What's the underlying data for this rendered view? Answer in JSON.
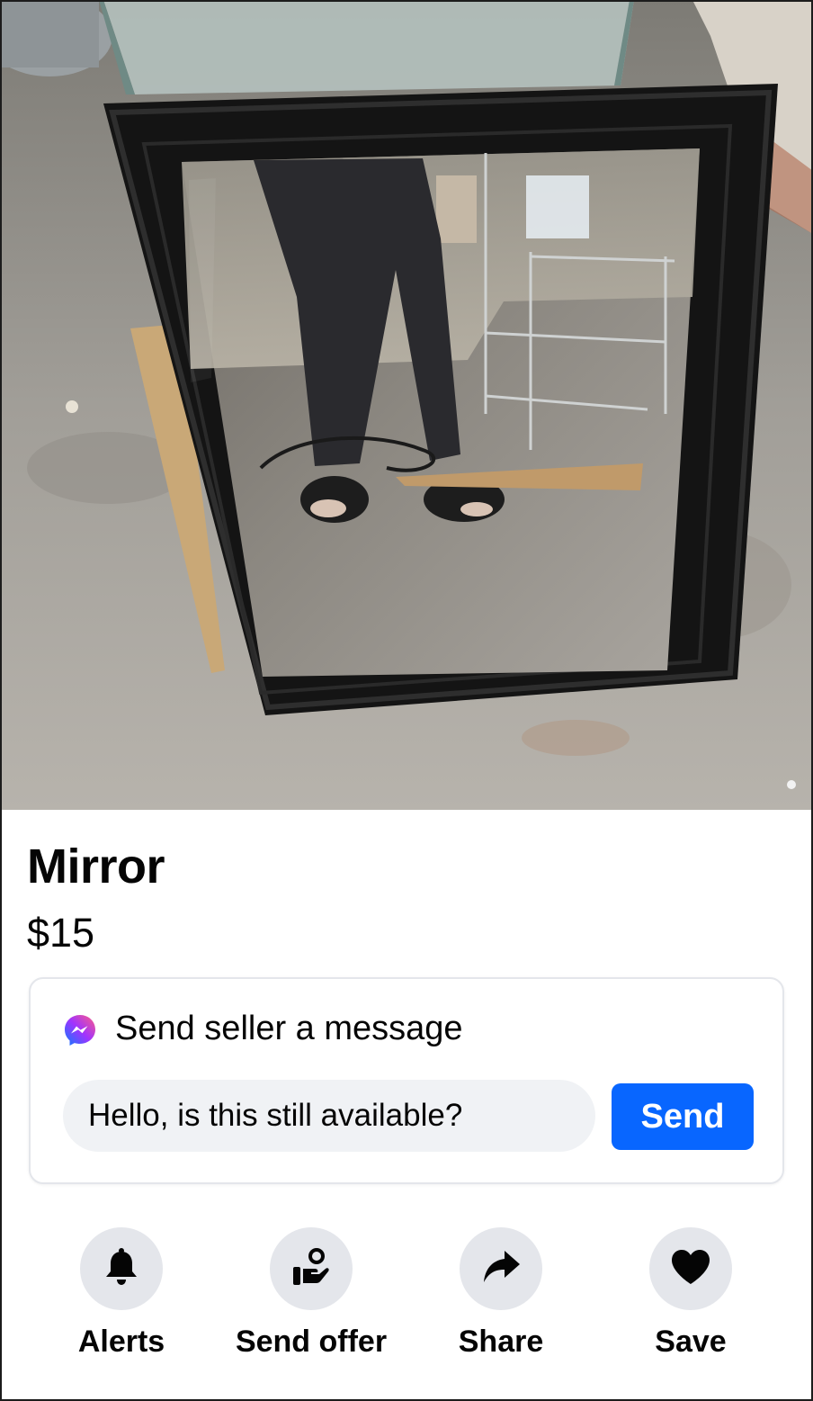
{
  "listing": {
    "title": "Mirror",
    "price": "$15",
    "photo_icon": "product-photo"
  },
  "message": {
    "heading": "Send seller a message",
    "input_value": "Hello, is this still available?",
    "send_label": "Send",
    "icon": "messenger-icon"
  },
  "actions": [
    {
      "label": "Alerts",
      "icon": "bell-icon"
    },
    {
      "label": "Send offer",
      "icon": "offer-hand-icon"
    },
    {
      "label": "Share",
      "icon": "share-arrow-icon"
    },
    {
      "label": "Save",
      "icon": "heart-icon"
    }
  ],
  "colors": {
    "accent": "#0866ff",
    "icon_bg": "#e4e6eb",
    "input_bg": "#f0f2f5",
    "text": "#050505"
  }
}
